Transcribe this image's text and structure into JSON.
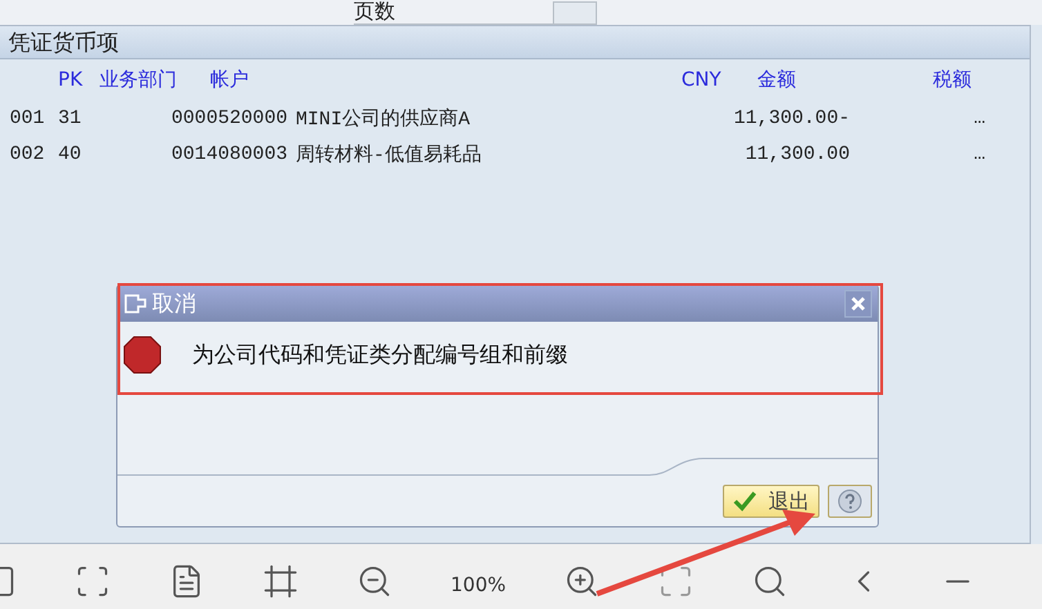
{
  "top_field": {
    "label": "页数"
  },
  "section": {
    "title": "凭证货币项",
    "columns": [
      "PK",
      "业务部门",
      "帐户",
      "CNY",
      "金额",
      "税额"
    ],
    "rows": [
      {
        "item": "001",
        "pk": "31",
        "account": "0000520000",
        "name": "MINI公司的供应商A",
        "amount": "11,300.00-",
        "tax": "…"
      },
      {
        "item": "002",
        "pk": "40",
        "account": "0014080003",
        "name": "周转材料-低值易耗品",
        "amount": "11,300.00",
        "tax": "…"
      }
    ]
  },
  "dialog": {
    "title": "取消",
    "message": "为公司代码和凭证类分配编号组和前缀",
    "buttons": [
      {
        "kind": "confirm",
        "label": "退出"
      },
      {
        "kind": "help"
      }
    ]
  },
  "toolbar": {
    "zoom": "100%"
  }
}
